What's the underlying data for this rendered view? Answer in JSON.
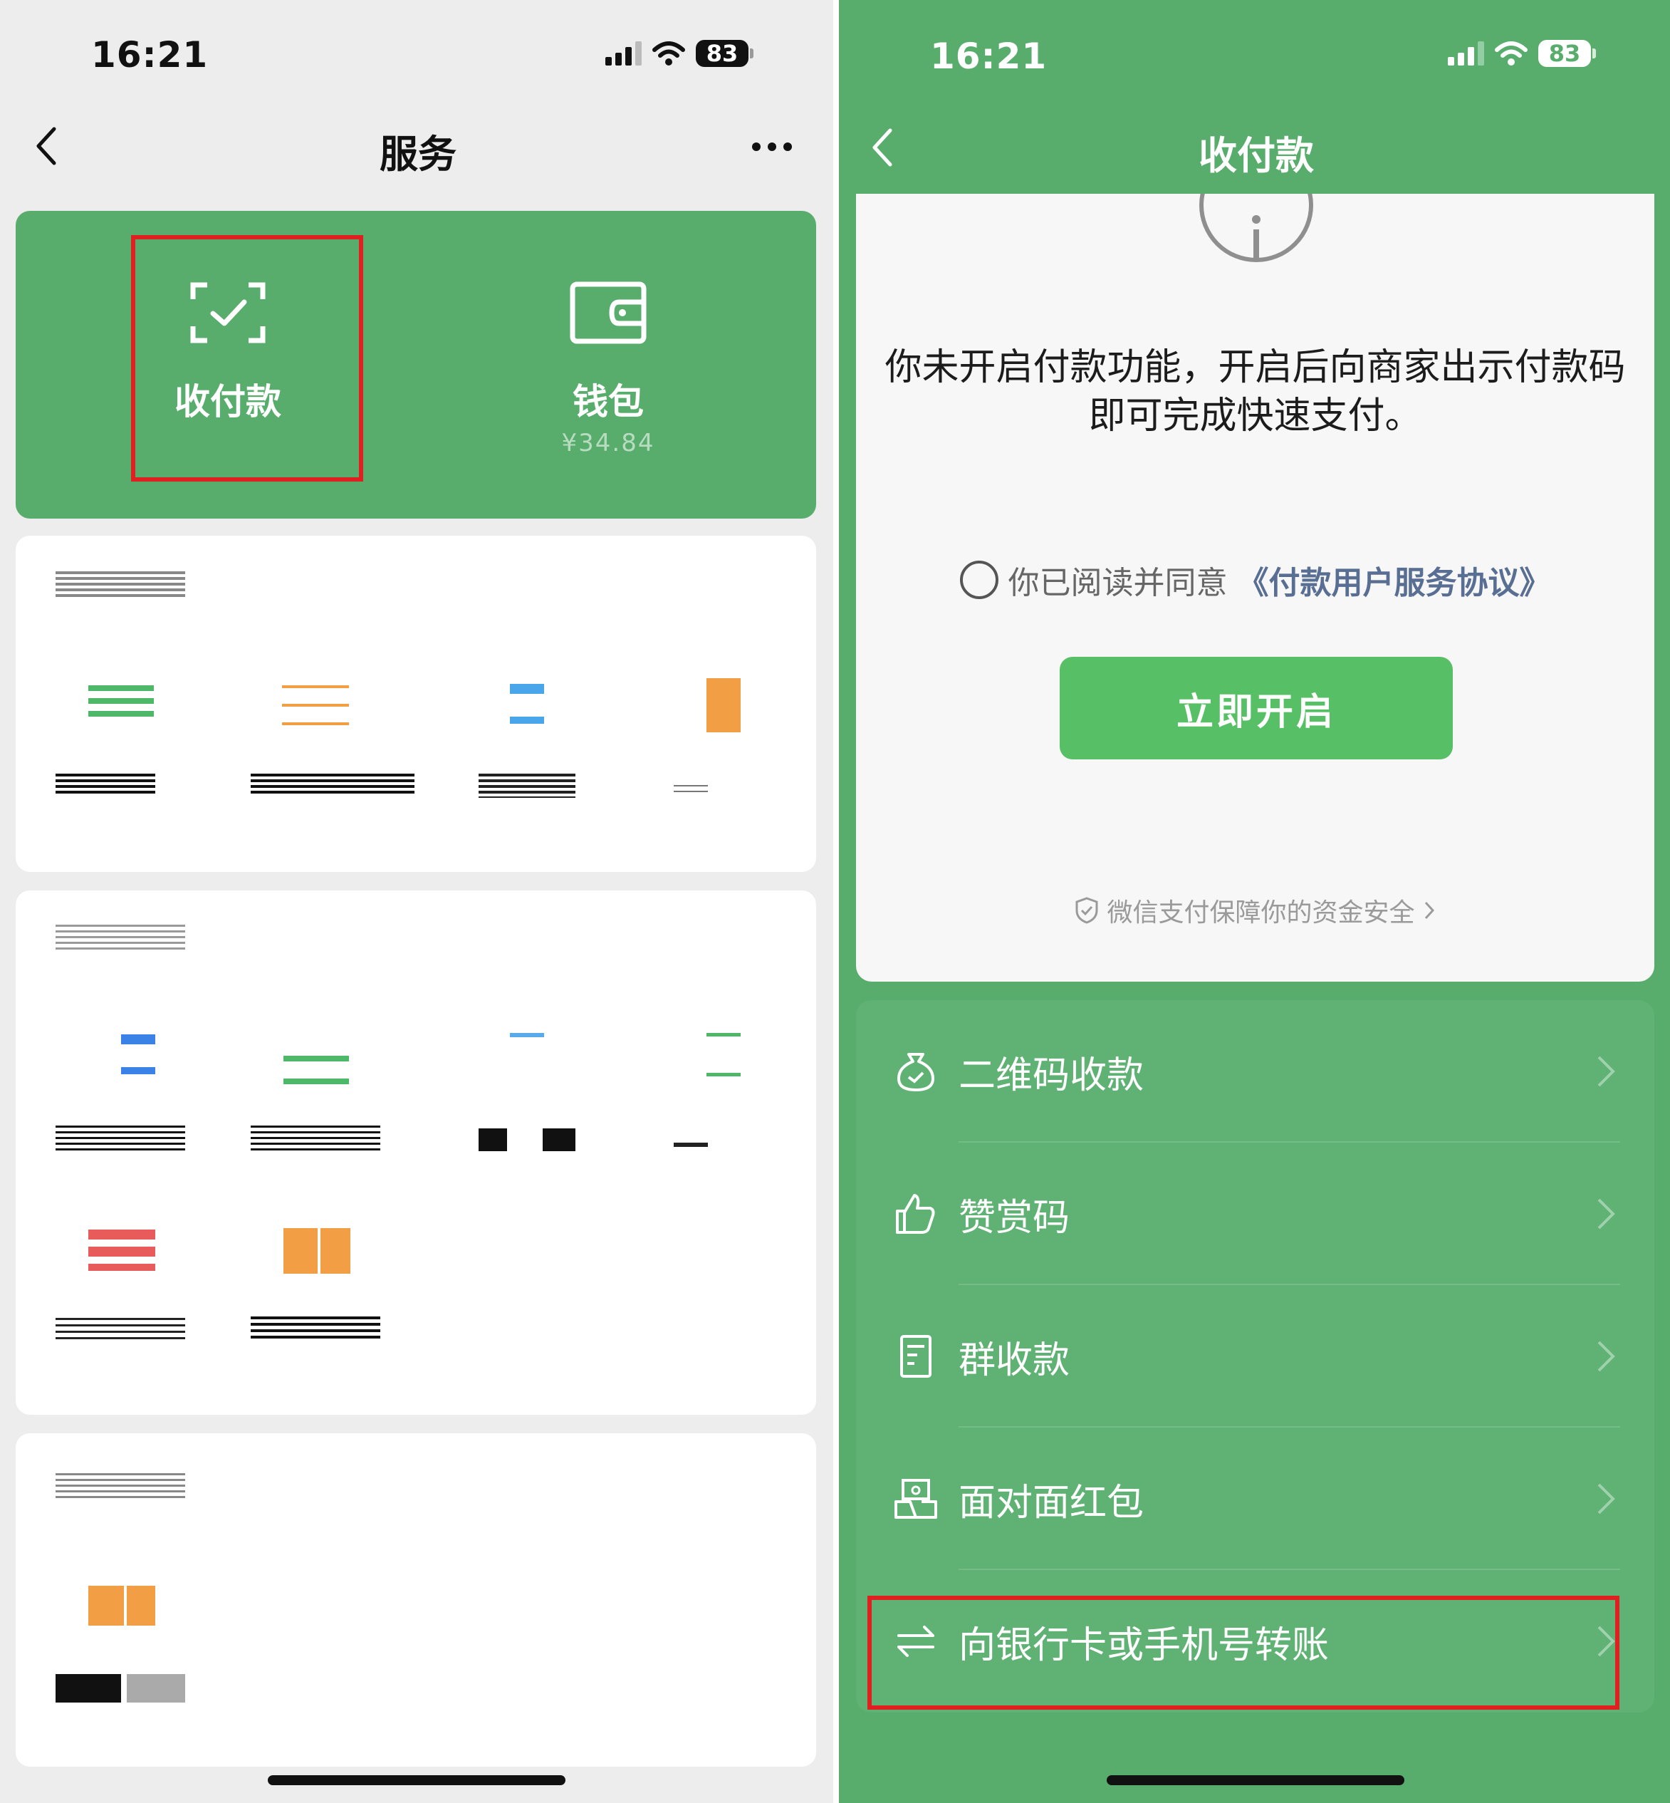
{
  "left": {
    "status": {
      "time": "16:21",
      "battery": "83"
    },
    "nav": {
      "title": "服务"
    },
    "green_card": {
      "payment_label": "收付款",
      "wallet_label": "钱包",
      "wallet_balance": "¥34.84"
    }
  },
  "right": {
    "status": {
      "time": "16:21",
      "battery": "83"
    },
    "nav": {
      "title": "收付款"
    },
    "info": {
      "message": "你未开启付款功能，开启后向商家出示付款码即可完成快速支付。",
      "agree_prefix": "你已阅读并同意",
      "agree_link": "《付款用户服务协议》",
      "open_button": "立即开启",
      "security_note": "微信支付保障你的资金安全"
    },
    "menu": [
      {
        "label": "二维码收款",
        "icon": "qr-money-bag-icon"
      },
      {
        "label": "赞赏码",
        "icon": "thumbs-up-icon"
      },
      {
        "label": "群收款",
        "icon": "group-receipt-icon"
      },
      {
        "label": "面对面红包",
        "icon": "face-to-face-red-packet-icon"
      },
      {
        "label": "向银行卡或手机号转账",
        "icon": "transfer-arrows-icon"
      }
    ]
  },
  "colors": {
    "brand_green": "#58ad6d",
    "button_green": "#57c066",
    "highlight_red": "#e02020",
    "link_blue": "#586e93"
  }
}
